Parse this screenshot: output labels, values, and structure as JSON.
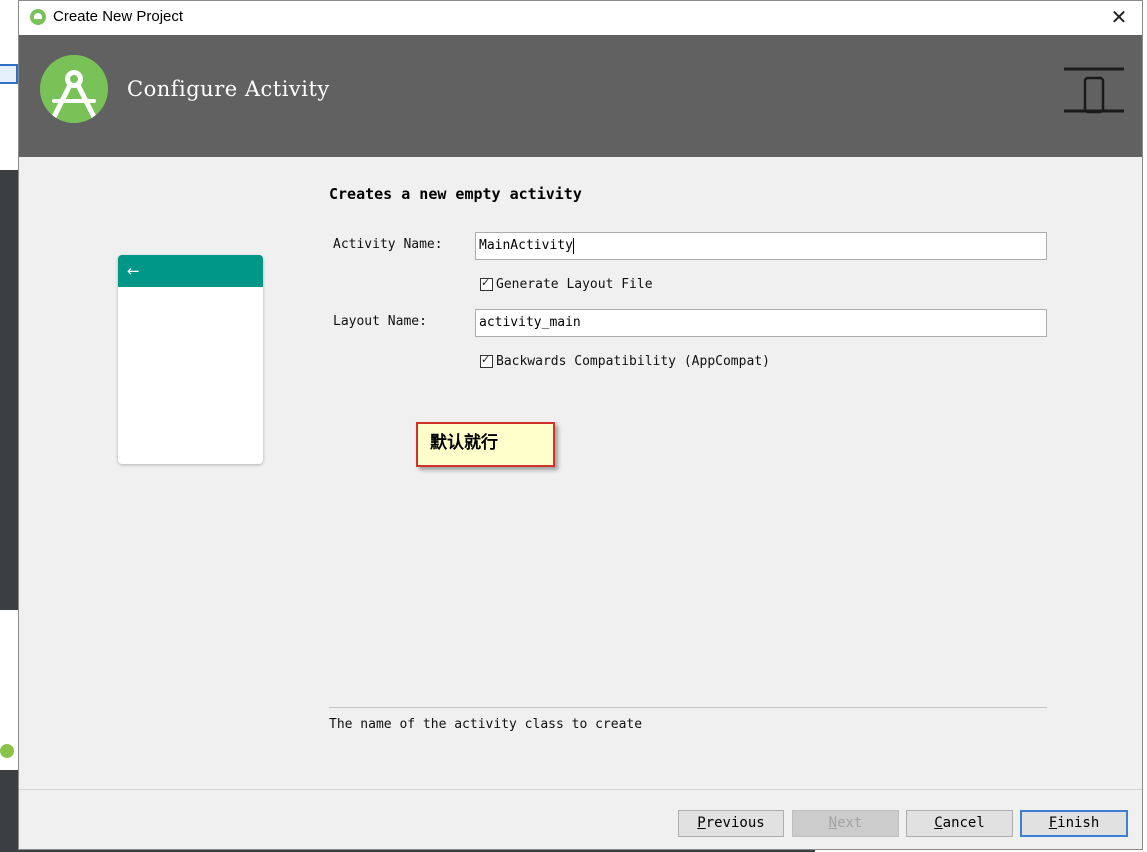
{
  "window": {
    "title": "Create New Project",
    "close_glyph": "✕"
  },
  "header": {
    "heading": "Configure Activity",
    "logo_icon": "android-studio-logo-icon",
    "form_factor_icon": "phone-form-factor-icon"
  },
  "preview": {
    "appbar_color": "#009688",
    "back_glyph": "←"
  },
  "form": {
    "title": "Creates a new empty activity",
    "activity_name_label": "Activity Name:",
    "activity_name_value": "MainActivity",
    "generate_layout_label": "Generate Layout File",
    "generate_layout_checked": true,
    "layout_name_label": "Layout Name:",
    "layout_name_value": "activity_main",
    "backwards_compat_label": "Backwards Compatibility (AppCompat)",
    "backwards_compat_checked": true
  },
  "annotation": {
    "text": "默认就行"
  },
  "description": "The name of the activity class to create",
  "buttons": {
    "previous_mn": "P",
    "previous_rest": "revious",
    "next_mn": "N",
    "next_rest": "ext",
    "cancel_mn": "C",
    "cancel_rest": "ancel",
    "finish_mn": "F",
    "finish_rest": "inish"
  },
  "colors": {
    "header_bg": "#616161",
    "android_green": "#78c257",
    "dialog_bg": "#f0f0f0",
    "annotation_border": "#d0312d",
    "annotation_bg": "#ffffcc",
    "primary_button_border": "#3f7fd1"
  }
}
